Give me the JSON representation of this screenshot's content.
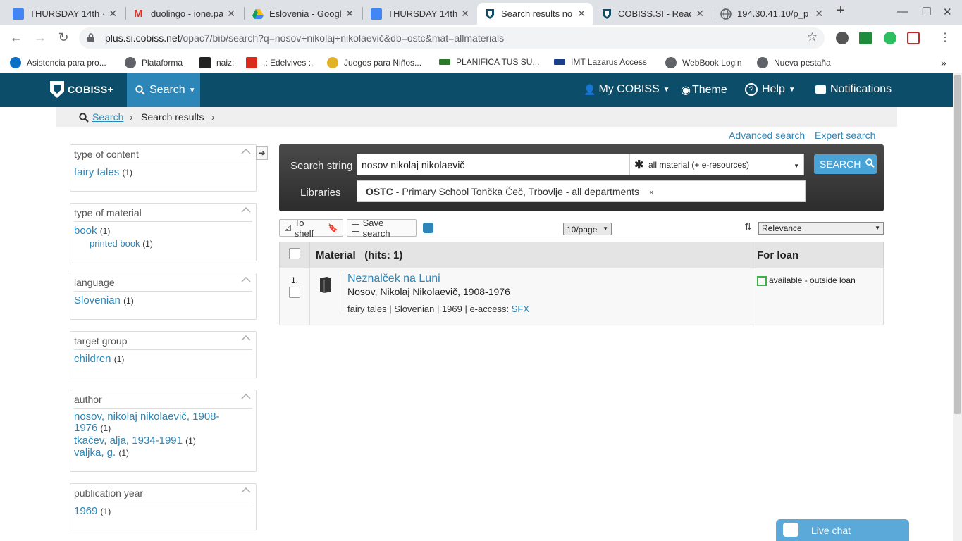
{
  "browser": {
    "tabs": [
      {
        "title": "THURSDAY 14th ·",
        "icon": "docs-icon",
        "color": "#4285f4"
      },
      {
        "title": "duolingo - ione.pa",
        "icon": "gmail-icon",
        "color": "#d93025"
      },
      {
        "title": "Eslovenia - Googl",
        "icon": "drive-icon",
        "color": "#fbbc04"
      },
      {
        "title": "THURSDAY 14th ·",
        "icon": "docs-icon",
        "color": "#4285f4"
      },
      {
        "title": "Search results no",
        "icon": "cobiss-icon",
        "color": "#0c4d69",
        "active": true
      },
      {
        "title": "COBISS.SI - Read",
        "icon": "cobiss-icon",
        "color": "#0c4d69"
      },
      {
        "title": "194.30.41.10/p_p",
        "icon": "globe-icon",
        "color": "#5f6368"
      }
    ],
    "url_host": "plus.si.cobiss.net",
    "url_path": "/opac7/bib/search?q=nosov+nikolaj+nikolaevič&db=ostc&mat=allmaterials",
    "bookmarks": [
      {
        "label": "Asistencia para pro...",
        "color": "#0b6fc6"
      },
      {
        "label": "Plataforma",
        "color": "#5f6368"
      },
      {
        "label": "naiz:",
        "color": "#222222"
      },
      {
        "label": ".: Edelvives :.",
        "color": "#d92a1c"
      },
      {
        "label": "Juegos para Niños...",
        "color": "#e0b324"
      },
      {
        "label": "PLANIFICA TUS SU...",
        "color": "#2a7a2a"
      },
      {
        "label": "IMT Lazarus Access",
        "color": "#1a3e8c"
      },
      {
        "label": "WebBook Login",
        "color": "#5f6368"
      },
      {
        "label": "Nueva pestaña",
        "color": "#5f6368"
      }
    ],
    "more": "»"
  },
  "app": {
    "logo": "COBISS+",
    "search_menu": "Search",
    "my_cobiss": "My COBISS",
    "theme": "Theme",
    "help": "Help",
    "notifications": "Notifications"
  },
  "breadcrumb": {
    "search": "Search",
    "results": "Search results"
  },
  "links": {
    "advanced": "Advanced search",
    "expert": "Expert search"
  },
  "facets": {
    "content": {
      "title": "type of content",
      "items": [
        {
          "label": "fairy tales",
          "count": "(1)"
        }
      ]
    },
    "material": {
      "title": "type of material",
      "items": [
        {
          "label": "book",
          "count": "(1)"
        },
        {
          "label": "printed book",
          "count": "(1)"
        }
      ]
    },
    "language": {
      "title": "language",
      "items": [
        {
          "label": "Slovenian",
          "count": "(1)"
        }
      ]
    },
    "target": {
      "title": "target group",
      "items": [
        {
          "label": "children",
          "count": "(1)"
        }
      ]
    },
    "author": {
      "title": "author",
      "items": [
        {
          "label": "nosov, nikolaj nikolaevič, 1908-1976",
          "count": "(1)"
        },
        {
          "label": "tkačev, alja, 1934-1991",
          "count": "(1)"
        },
        {
          "label": "valjka, g.",
          "count": "(1)"
        }
      ]
    },
    "year": {
      "title": "publication year",
      "items": [
        {
          "label": "1969",
          "count": "(1)"
        }
      ]
    }
  },
  "search": {
    "string_label": "Search string",
    "query": "nosov nikolaj nikolaevič",
    "material_select": "all material (+ e-resources)",
    "button": "SEARCH",
    "libraries_label": "Libraries",
    "library_code": "OSTC",
    "library_name": " - Primary School Tončka Čeč, Trbovlje - all departments",
    "remove": "×"
  },
  "actions": {
    "to_shelf": "To shelf",
    "save_search": "Save search",
    "per_page": "10/page",
    "sort": "Relevance"
  },
  "results": {
    "col_material": "Material",
    "hits": "(hits: 1)",
    "col_loan": "For loan",
    "rows": [
      {
        "num": "1.",
        "title": "Neznalček na Luni",
        "author": "Nosov, Nikolaj Nikolaevič, 1908-1976",
        "meta": "fairy tales | Slovenian | 1969 | e-access: ",
        "sfx": "SFX",
        "loan": "available - outside loan"
      }
    ]
  },
  "livechat": "Live chat"
}
